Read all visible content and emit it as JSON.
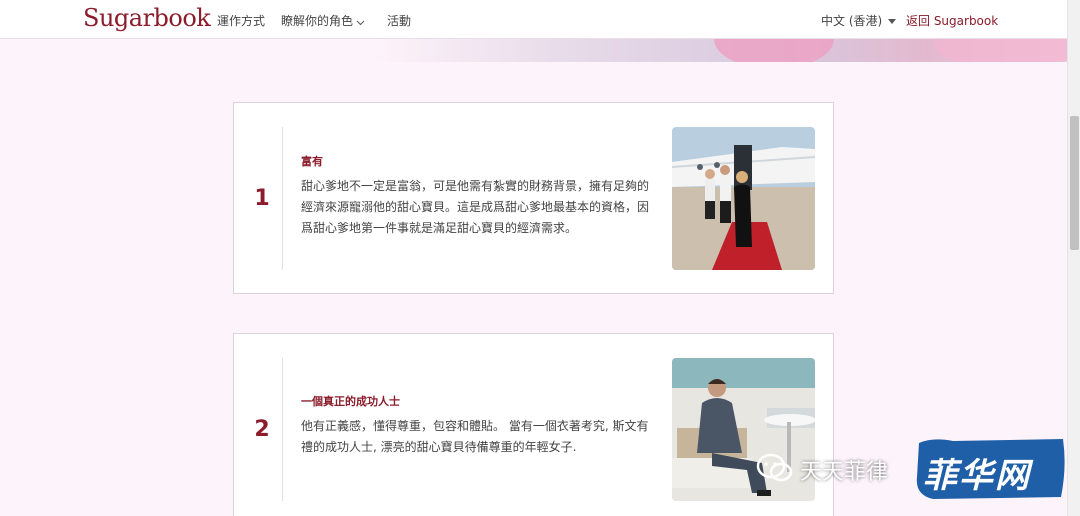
{
  "header": {
    "logo": "Sugarbook",
    "nav": [
      "運作方式",
      "瞭解你的角色",
      "活動"
    ],
    "language": "中文 (香港)",
    "back_link": "返回 Sugarbook"
  },
  "cards": [
    {
      "number": "1",
      "title": "富有",
      "text": "甜心爹地不一定是富翁，可是他需有紮實的財務背景，擁有足夠的經濟來源寵溺他的甜心寶貝。這是成爲甜心爹地最基本的資格，因爲甜心爹地第一件事就是滿足甜心寶貝的經濟需求。"
    },
    {
      "number": "2",
      "title": "一個真正的成功人士",
      "text": "他有正義感，懂得尊重，包容和體貼。 當有一個衣著考究, 斯文有禮的成功人士, 漂亮的甜心寶貝待備尊重的年輕女子."
    }
  ],
  "watermark": {
    "text": "天天菲律",
    "badge": "菲华网"
  },
  "colors": {
    "brand": "#8a1c2b",
    "background": "#fdf3fa",
    "badge": "#1f5fa8"
  }
}
